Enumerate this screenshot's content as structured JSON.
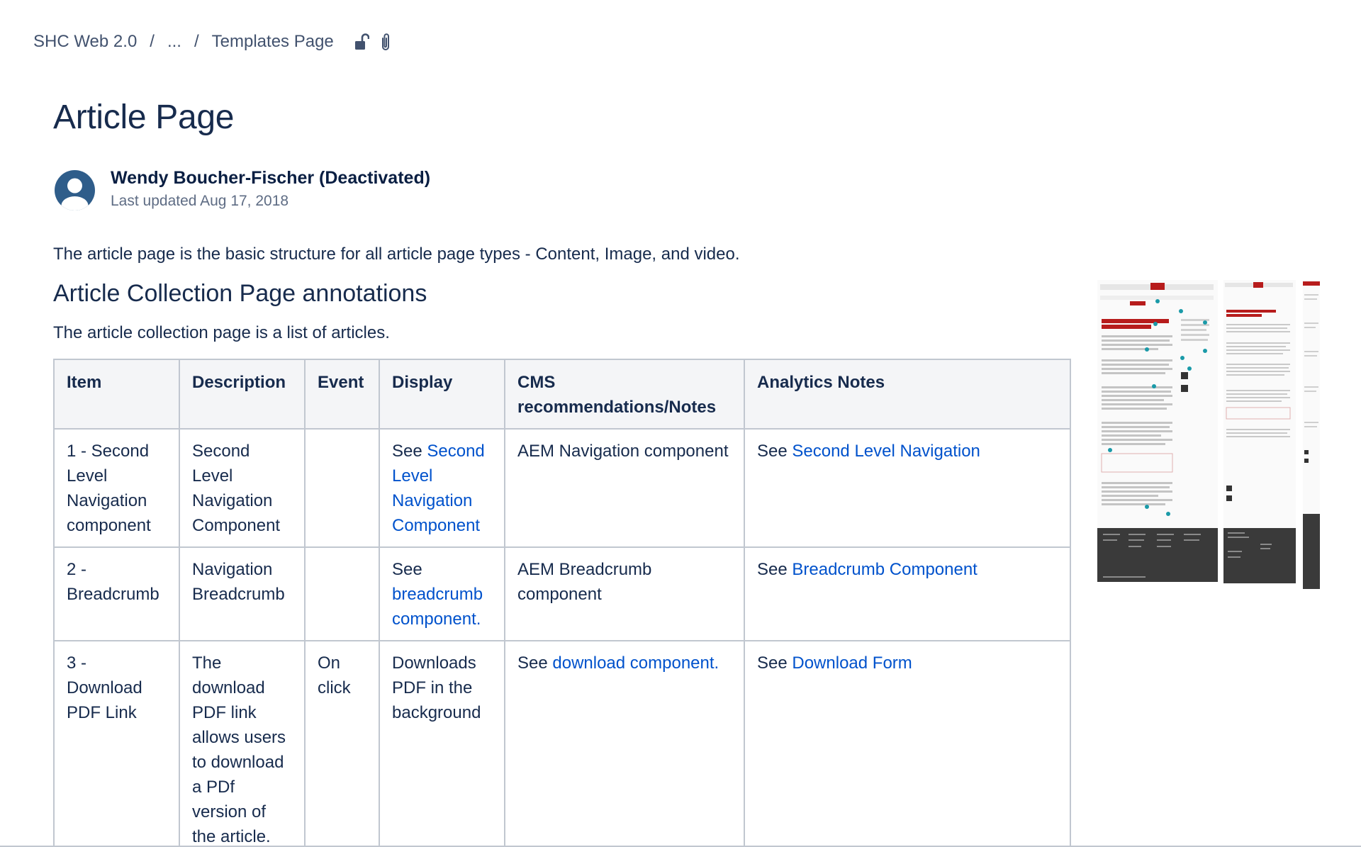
{
  "breadcrumb": {
    "items": [
      {
        "label": "SHC Web 2.0"
      },
      {
        "label": "..."
      },
      {
        "label": "Templates Page"
      }
    ],
    "separator": "/"
  },
  "page": {
    "title": "Article Page"
  },
  "byline": {
    "author": "Wendy Boucher-Fischer (Deactivated)",
    "updated": "Last updated Aug 17, 2018"
  },
  "intro": "The article page is the basic structure for all article page types - Content, Image, and video.",
  "section": {
    "heading": "Article Collection Page annotations",
    "description": "The article collection page is a list of articles."
  },
  "table": {
    "headers": [
      "Item",
      "Description",
      "Event",
      "Display",
      "CMS recommendations/Notes",
      "Analytics Notes"
    ],
    "rows": [
      {
        "item": "1 - Second Level Navigation component",
        "description": "Second Level Navigation Component",
        "event": "",
        "display_prefix": "See ",
        "display_link": "Second Level Navigation Component",
        "display_suffix": "",
        "cms_prefix": "AEM Navigation component",
        "cms_link": "",
        "analytics_prefix": "See ",
        "analytics_link": "Second Level Navigation"
      },
      {
        "item": "2 - Breadcrumb",
        "description": "Navigation Breadcrumb",
        "event": "",
        "display_prefix": "See ",
        "display_link": "breadcrumb component.",
        "display_suffix": "",
        "cms_prefix": "AEM Breadcrumb component",
        "cms_link": "",
        "analytics_prefix": "See ",
        "analytics_link": "Breadcrumb Component"
      },
      {
        "item": "3 - Download PDF Link",
        "description": "The download PDF link allows users to download a PDf version of the article.",
        "event": "On click",
        "display_prefix": "Downloads PDF in the background",
        "display_link": "",
        "display_suffix": "",
        "cms_prefix": "See ",
        "cms_link": "download component.",
        "analytics_prefix": "See ",
        "analytics_link": "Download Form"
      }
    ]
  },
  "icons": {
    "restriction": "unlocked-padlock-icon",
    "attachment": "paperclip-icon",
    "avatar": "user-avatar-icon"
  },
  "colors": {
    "link": "#0052cc",
    "text": "#172b4d",
    "header_bg": "#f4f5f7",
    "border": "#c1c7d0",
    "avatar": "#2f5d8a"
  }
}
